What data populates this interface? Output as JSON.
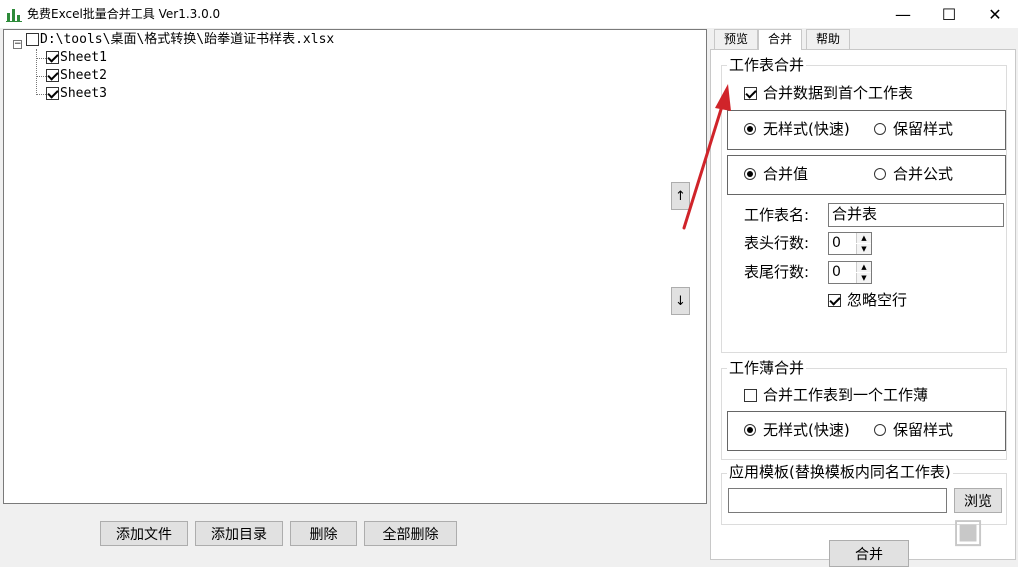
{
  "window": {
    "title": "免费Excel批量合并工具 Ver1.3.0.0",
    "minimize": "—",
    "maximize": "☐",
    "close": "✕"
  },
  "tree": {
    "root": "D:\\tools\\桌面\\格式转换\\跆拳道证书样表.xlsx",
    "sheets": [
      "Sheet1",
      "Sheet2",
      "Sheet3"
    ],
    "expander": "−"
  },
  "arrows": {
    "up": "↑",
    "down": "↓"
  },
  "bottom_buttons": {
    "add_file": "添加文件",
    "add_dir": "添加目录",
    "delete": "删除",
    "delete_all": "全部删除"
  },
  "tabs": [
    "预览",
    "合并",
    "帮助"
  ],
  "sheet_merge": {
    "group_title": "工作表合并",
    "merge_to_first": "合并数据到首个工作表",
    "no_style": "无样式(快速)",
    "keep_style": "保留样式",
    "merge_values": "合并值",
    "merge_formulas": "合并公式",
    "sheet_name_label": "工作表名:",
    "sheet_name_value": "合并表",
    "header_rows_label": "表头行数:",
    "header_rows_value": "0",
    "footer_rows_label": "表尾行数:",
    "footer_rows_value": "0",
    "ignore_blank": "忽略空行"
  },
  "book_merge": {
    "group_title": "工作薄合并",
    "merge_to_one_book": "合并工作表到一个工作薄",
    "no_style": "无样式(快速)",
    "keep_style": "保留样式"
  },
  "template": {
    "group_title": "应用模板(替换模板内同名工作表)",
    "browse": "浏览"
  },
  "merge_button": "合并",
  "colors": {
    "arrow": "#d0242a",
    "accent_frame": "#666666"
  }
}
